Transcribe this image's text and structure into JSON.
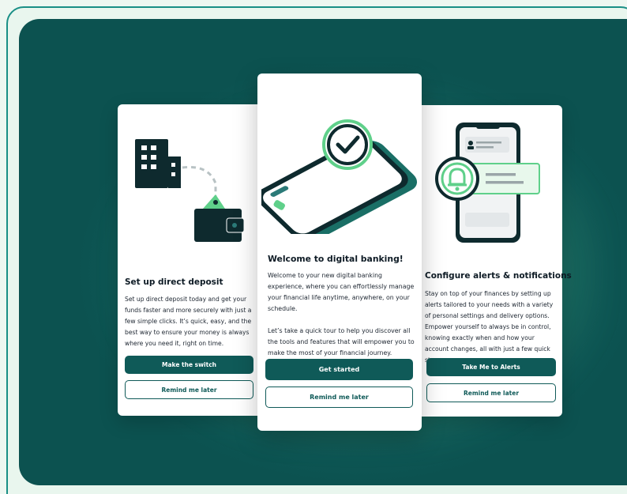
{
  "cards": {
    "left": {
      "title": "Set up direct deposit",
      "body": "Set up direct deposit today and get your funds faster and more securely with just a few simple clicks. It’s quick, easy, and the best way to ensure your money is always where you need it, right on time.",
      "primary_label": "Make the switch",
      "secondary_label": "Remind me later",
      "illustration": "building-wallet-icon"
    },
    "center": {
      "title": "Welcome to digital banking!",
      "body_p1": "Welcome to your new digital banking experience, where you can effortlessly manage your financial life anytime, anywhere, on your schedule.",
      "body_p2": "Let’s take a quick tour to help you discover all the tools and features that will empower you to make the most of your financial journey.",
      "primary_label": "Get started",
      "secondary_label": "Remind me later",
      "illustration": "phone-checkmark-icon"
    },
    "right": {
      "title": "Configure alerts & notifications",
      "body": "Stay on top of your finances by setting up alerts tailored to your needs with a variety of personal settings and delivery options. Empower yourself to always be in control, knowing exactly when and how your account changes, all with just a few quick steps.",
      "primary_label": "Take Me to Alerts",
      "secondary_label": "Remind me later",
      "illustration": "phone-bell-icon"
    }
  },
  "colors": {
    "primary": "#0f5a58",
    "accent_green": "#5fd08a",
    "dark": "#0e2a2e",
    "frame_border": "#1a8f86"
  }
}
